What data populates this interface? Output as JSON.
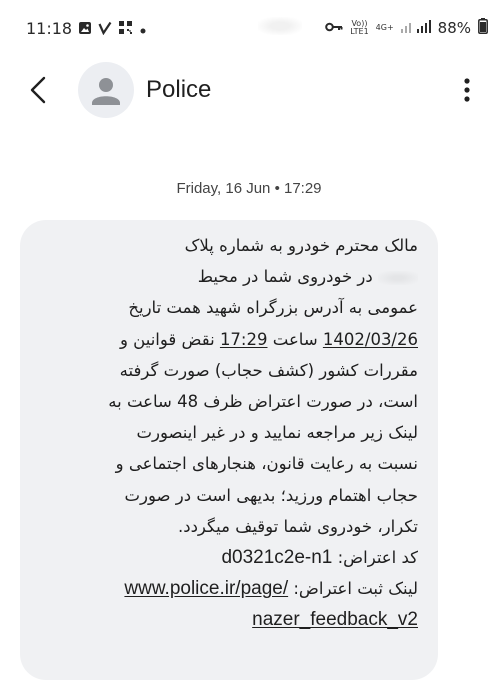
{
  "status_bar": {
    "time": "11:18",
    "volte_label": "Vo))\nLTE1",
    "network_label": "4G+",
    "battery_percent": "88%",
    "left_icons": [
      "gallery-icon",
      "check-icon",
      "qr-app-icon",
      "dot-icon"
    ],
    "right_icons": [
      "key-icon",
      "volte-icon",
      "signal-icon",
      "battery-icon"
    ]
  },
  "header": {
    "contact_name": "Police",
    "back_icon": "back-arrow-icon",
    "avatar_icon": "person-icon",
    "more_icon": "more-vertical-icon"
  },
  "conversation": {
    "date_label": "Friday, 16 Jun • 17:29",
    "message": {
      "line1": "مالک محترم خودرو به شماره پلاک",
      "line2_pre": " در خودروی شما در محیط",
      "line3": "عمومی به آدرس بزرگراه شهید همت  تاریخ",
      "line4_date": "1402/03/26",
      "line4_mid": " ساعت ",
      "line4_time": "17:29",
      "line4_post": " نقض قوانین و",
      "line5": "مقررات کشور (کشف حجاب) صورت گرفته",
      "line6": "است، در صورت اعتراض ظرف 48 ساعت به",
      "line7": "لینک زیر مراجعه نمایید و در غیر اینصورت",
      "line8": "نسبت به رعایت قانون، هنجارهای اجتماعی و",
      "line9": "حجاب اهتمام ورزید؛ بدیهی است در صورت",
      "line10": "تکرار، خودروی شما توقیف میگردد.",
      "code_label": "کد اعتراض: ",
      "code_value": "d0321c2e-n1",
      "link_label": "لینک ثبت اعتراض: ",
      "link_part1": "www.police.ir/page/",
      "link_part2": "nazer_feedback_v2"
    }
  },
  "colors": {
    "background": "#ffffff",
    "bubble": "#f0f1f3",
    "text": "#1f1f1f",
    "avatar_bg": "#eceef2",
    "avatar_fg": "#8e9196"
  }
}
